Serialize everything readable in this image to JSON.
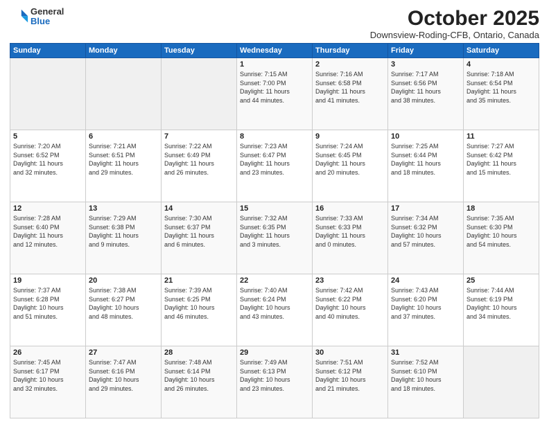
{
  "header": {
    "logo_general": "General",
    "logo_blue": "Blue",
    "month_title": "October 2025",
    "location": "Downsview-Roding-CFB, Ontario, Canada"
  },
  "weekdays": [
    "Sunday",
    "Monday",
    "Tuesday",
    "Wednesday",
    "Thursday",
    "Friday",
    "Saturday"
  ],
  "weeks": [
    [
      {
        "day": "",
        "info": ""
      },
      {
        "day": "",
        "info": ""
      },
      {
        "day": "",
        "info": ""
      },
      {
        "day": "1",
        "info": "Sunrise: 7:15 AM\nSunset: 7:00 PM\nDaylight: 11 hours\nand 44 minutes."
      },
      {
        "day": "2",
        "info": "Sunrise: 7:16 AM\nSunset: 6:58 PM\nDaylight: 11 hours\nand 41 minutes."
      },
      {
        "day": "3",
        "info": "Sunrise: 7:17 AM\nSunset: 6:56 PM\nDaylight: 11 hours\nand 38 minutes."
      },
      {
        "day": "4",
        "info": "Sunrise: 7:18 AM\nSunset: 6:54 PM\nDaylight: 11 hours\nand 35 minutes."
      }
    ],
    [
      {
        "day": "5",
        "info": "Sunrise: 7:20 AM\nSunset: 6:52 PM\nDaylight: 11 hours\nand 32 minutes."
      },
      {
        "day": "6",
        "info": "Sunrise: 7:21 AM\nSunset: 6:51 PM\nDaylight: 11 hours\nand 29 minutes."
      },
      {
        "day": "7",
        "info": "Sunrise: 7:22 AM\nSunset: 6:49 PM\nDaylight: 11 hours\nand 26 minutes."
      },
      {
        "day": "8",
        "info": "Sunrise: 7:23 AM\nSunset: 6:47 PM\nDaylight: 11 hours\nand 23 minutes."
      },
      {
        "day": "9",
        "info": "Sunrise: 7:24 AM\nSunset: 6:45 PM\nDaylight: 11 hours\nand 20 minutes."
      },
      {
        "day": "10",
        "info": "Sunrise: 7:25 AM\nSunset: 6:44 PM\nDaylight: 11 hours\nand 18 minutes."
      },
      {
        "day": "11",
        "info": "Sunrise: 7:27 AM\nSunset: 6:42 PM\nDaylight: 11 hours\nand 15 minutes."
      }
    ],
    [
      {
        "day": "12",
        "info": "Sunrise: 7:28 AM\nSunset: 6:40 PM\nDaylight: 11 hours\nand 12 minutes."
      },
      {
        "day": "13",
        "info": "Sunrise: 7:29 AM\nSunset: 6:38 PM\nDaylight: 11 hours\nand 9 minutes."
      },
      {
        "day": "14",
        "info": "Sunrise: 7:30 AM\nSunset: 6:37 PM\nDaylight: 11 hours\nand 6 minutes."
      },
      {
        "day": "15",
        "info": "Sunrise: 7:32 AM\nSunset: 6:35 PM\nDaylight: 11 hours\nand 3 minutes."
      },
      {
        "day": "16",
        "info": "Sunrise: 7:33 AM\nSunset: 6:33 PM\nDaylight: 11 hours\nand 0 minutes."
      },
      {
        "day": "17",
        "info": "Sunrise: 7:34 AM\nSunset: 6:32 PM\nDaylight: 10 hours\nand 57 minutes."
      },
      {
        "day": "18",
        "info": "Sunrise: 7:35 AM\nSunset: 6:30 PM\nDaylight: 10 hours\nand 54 minutes."
      }
    ],
    [
      {
        "day": "19",
        "info": "Sunrise: 7:37 AM\nSunset: 6:28 PM\nDaylight: 10 hours\nand 51 minutes."
      },
      {
        "day": "20",
        "info": "Sunrise: 7:38 AM\nSunset: 6:27 PM\nDaylight: 10 hours\nand 48 minutes."
      },
      {
        "day": "21",
        "info": "Sunrise: 7:39 AM\nSunset: 6:25 PM\nDaylight: 10 hours\nand 46 minutes."
      },
      {
        "day": "22",
        "info": "Sunrise: 7:40 AM\nSunset: 6:24 PM\nDaylight: 10 hours\nand 43 minutes."
      },
      {
        "day": "23",
        "info": "Sunrise: 7:42 AM\nSunset: 6:22 PM\nDaylight: 10 hours\nand 40 minutes."
      },
      {
        "day": "24",
        "info": "Sunrise: 7:43 AM\nSunset: 6:20 PM\nDaylight: 10 hours\nand 37 minutes."
      },
      {
        "day": "25",
        "info": "Sunrise: 7:44 AM\nSunset: 6:19 PM\nDaylight: 10 hours\nand 34 minutes."
      }
    ],
    [
      {
        "day": "26",
        "info": "Sunrise: 7:45 AM\nSunset: 6:17 PM\nDaylight: 10 hours\nand 32 minutes."
      },
      {
        "day": "27",
        "info": "Sunrise: 7:47 AM\nSunset: 6:16 PM\nDaylight: 10 hours\nand 29 minutes."
      },
      {
        "day": "28",
        "info": "Sunrise: 7:48 AM\nSunset: 6:14 PM\nDaylight: 10 hours\nand 26 minutes."
      },
      {
        "day": "29",
        "info": "Sunrise: 7:49 AM\nSunset: 6:13 PM\nDaylight: 10 hours\nand 23 minutes."
      },
      {
        "day": "30",
        "info": "Sunrise: 7:51 AM\nSunset: 6:12 PM\nDaylight: 10 hours\nand 21 minutes."
      },
      {
        "day": "31",
        "info": "Sunrise: 7:52 AM\nSunset: 6:10 PM\nDaylight: 10 hours\nand 18 minutes."
      },
      {
        "day": "",
        "info": ""
      }
    ]
  ]
}
